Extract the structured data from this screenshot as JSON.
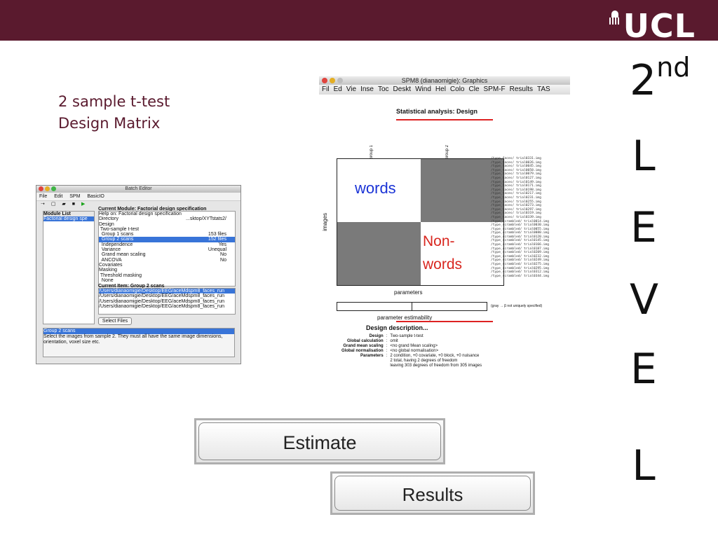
{
  "brand": {
    "logo_text": "UCL",
    "band_color": "#5a1a2e"
  },
  "level": {
    "number": "2",
    "suffix": "nd",
    "letters": [
      "L",
      "E",
      "V",
      "E",
      "L"
    ]
  },
  "slide": {
    "title_line1": "2 sample t-test",
    "title_line2": "Design Matrix"
  },
  "batch_editor": {
    "title": "Batch Editor",
    "menu": [
      "File",
      "Edit",
      "SPM",
      "BasicIO"
    ],
    "module_list_header": "Module List",
    "module_selected": "Factorial design spe",
    "current_module_header": "Current Module: Factorial design specification",
    "rows": [
      {
        "label": "Help on: Factorial design specification",
        "value": ""
      },
      {
        "label": "Directory",
        "value": "...sktop/XYTstats2/"
      },
      {
        "label": "Design",
        "value": ""
      },
      {
        "label": " Two-sample t-test",
        "value": ""
      },
      {
        "label": "  Group 1 scans",
        "value": "153 files"
      },
      {
        "label": "  Group 2 scans",
        "value": "152 files",
        "selected": true
      },
      {
        "label": "  Independence",
        "value": "Yes"
      },
      {
        "label": "  Variance",
        "value": "Unequal"
      },
      {
        "label": "  Grand mean scaling",
        "value": "No"
      },
      {
        "label": "  ANCOVA",
        "value": "No"
      },
      {
        "label": "Covariates",
        "value": ""
      },
      {
        "label": "Masking",
        "value": ""
      },
      {
        "label": " Threshold masking",
        "value": ""
      },
      {
        "label": "  None",
        "value": ""
      }
    ],
    "current_item_header": "Current Item: Group 2 scans",
    "item_paths": [
      "/Users/dianaomigie/Desktop/EEG/aceMdspm8_faces_run",
      "/Users/dianaomigie/Desktop/EEG/aceMdspm8_faces_run",
      "/Users/dianaomigie/Desktop/EEG/aceMdspm8_faces_run",
      "/Users/dianaomigie/Desktop/EEG/aceMdspm8_faces_run"
    ],
    "select_files": "Select Files",
    "help_title": "Group 2 scans",
    "help_text": "Select the images from sample 2. They must all have the same image dimensions, orientation, voxel size etc."
  },
  "spm": {
    "title": "SPM8 (dianaomigie): Graphics",
    "menu": [
      "Fil",
      "Ed",
      "Vie",
      "Inse",
      "Toc",
      "Deskt",
      "Wind",
      "Hel",
      "Colo",
      "Cle",
      "SPM-F",
      "Results",
      "TAS"
    ],
    "stat_title": "Statistical analysis: Design",
    "group1": "Group 1",
    "group2": "Group 2",
    "images_label": "images",
    "params_label": "parameters",
    "words_label": "words",
    "non_label_1": "Non-",
    "non_label_2": "words",
    "estim_title": "parameter estimability",
    "estim_note": "(gray → β not uniquely specified)",
    "design_desc_title": "Design description...",
    "description": [
      {
        "key": "Design",
        "value": "Two-sample t-test"
      },
      {
        "key": "Global calculation",
        "value": "omit"
      },
      {
        "key": "Grand mean scaling",
        "value": "<no grand Mean scaling>"
      },
      {
        "key": "Global normalisation",
        "value": "<no global normalisation>"
      },
      {
        "key": "Parameters",
        "value": "2 condition, +0 covariate, +0 block, +0 nuisance"
      },
      {
        "key": "",
        "value": "2 total, having 2 degrees of freedom"
      },
      {
        "key": "",
        "value": "leaving 303 degrees of freedom from 305 images"
      }
    ],
    "files": [
      "/type_faces/ trial0331.img",
      "/type_faces/ trial0026.img",
      "/type_faces/ trial0045.img",
      "/type_faces/ trial0058.img",
      "/type_faces/ trial0079.img",
      "/type_faces/ trial0127.img",
      "/type_faces/ trial0149.img",
      "/type_faces/ trial0171.img",
      "/type_faces/ trial0198.img",
      "/type_faces/ trial0217.img",
      "/type_faces/ trial0231.img",
      "/type_faces/ trial0255.img",
      "/type_faces/ trial0273.img",
      "/type_faces/ trial0297.img",
      "/type_faces/ trial0319.img",
      "/type_faces/ trial0339.img",
      "/type_scrambled/ trial0014.img",
      "/type_scrambled/ trial0030.img",
      "/type_scrambled/ trial0055.img",
      "/type_scrambled/ trial0080.img",
      "/type_scrambled/ trial0120.img",
      "/type_scrambled/ trial0145.img",
      "/type_scrambled/ trial0166.img",
      "/type_scrambled/ trial0187.img",
      "/type_scrambled/ trial0209.img",
      "/type_scrambled/ trial0232.img",
      "/type_scrambled/ trial0249.img",
      "/type_scrambled/ trial0275.img",
      "/type_scrambled/ trial0295.img",
      "/type_scrambled/ trial0312.img",
      "/type_scrambled/ trial0344.img"
    ]
  },
  "buttons": {
    "estimate": "Estimate",
    "results": "Results"
  },
  "colors": {
    "words": "#1a33d6",
    "nonwords": "#d8261f",
    "underline": "#dd2222",
    "matrix_gray": "#7a7a7a"
  }
}
